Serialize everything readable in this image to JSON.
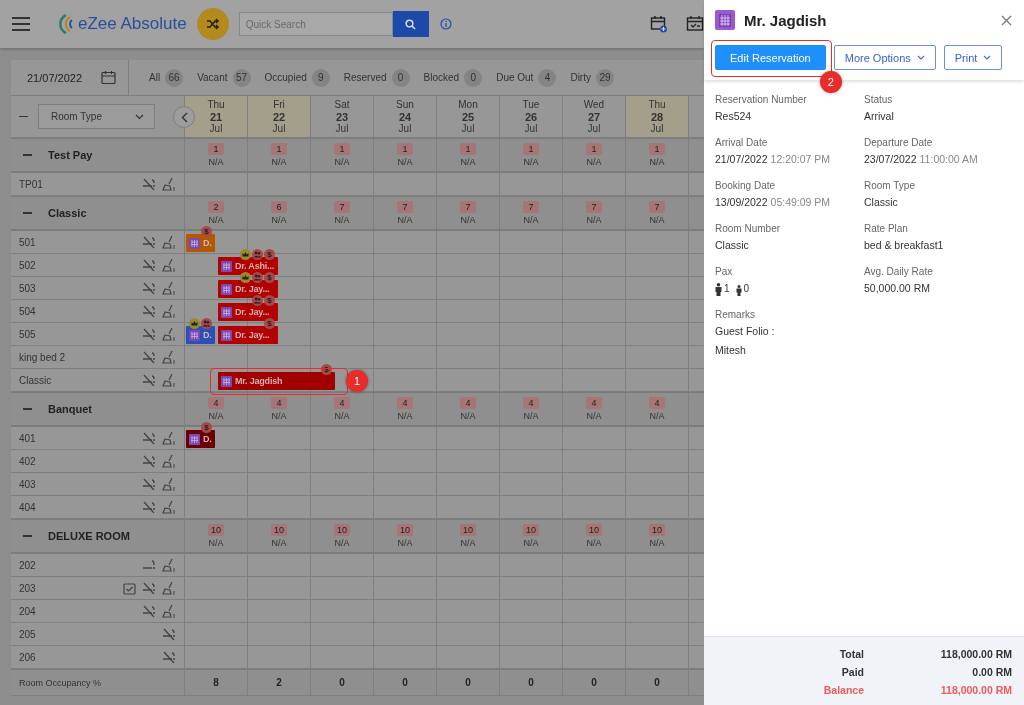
{
  "top_bar": {
    "app_name": "eZee Absolute",
    "search": {
      "placeholder": "Quick Search"
    }
  },
  "filters": {
    "date": "21/07/2022",
    "items": [
      {
        "label": "All",
        "count": "66"
      },
      {
        "label": "Vacant",
        "count": "57"
      },
      {
        "label": "Occupied",
        "count": "9"
      },
      {
        "label": "Reserved",
        "count": "0"
      },
      {
        "label": "Blocked",
        "count": "0"
      },
      {
        "label": "Due Out",
        "count": "4"
      },
      {
        "label": "Dirty",
        "count": "29"
      }
    ]
  },
  "grid": {
    "view_select": "Room Type",
    "days": [
      {
        "weekday": "Thu",
        "date": "21",
        "month": "Jul",
        "highlighted": true
      },
      {
        "weekday": "Fri",
        "date": "22",
        "month": "Jul",
        "highlighted": true
      },
      {
        "weekday": "Sat",
        "date": "23",
        "month": "Jul",
        "highlighted": false
      },
      {
        "weekday": "Sun",
        "date": "24",
        "month": "Jul",
        "highlighted": false
      },
      {
        "weekday": "Mon",
        "date": "25",
        "month": "Jul",
        "highlighted": false
      },
      {
        "weekday": "Tue",
        "date": "26",
        "month": "Jul",
        "highlighted": false
      },
      {
        "weekday": "Wed",
        "date": "27",
        "month": "Jul",
        "highlighted": false
      },
      {
        "weekday": "Thu",
        "date": "28",
        "month": "Jul",
        "highlighted": true
      }
    ],
    "groups": [
      {
        "name": "Test Pay",
        "availability": [
          "1",
          "1",
          "1",
          "1",
          "1",
          "1",
          "1",
          "1"
        ],
        "rates": [
          "N/A",
          "N/A",
          "N/A",
          "N/A",
          "N/A",
          "N/A",
          "N/A",
          "N/A"
        ],
        "rooms": [
          {
            "name": "TP01",
            "icons": [
              {
                "kind": "no_smoking"
              },
              {
                "kind": "dirty"
              }
            ]
          }
        ]
      },
      {
        "name": "Classic",
        "availability": [
          "2",
          "6",
          "7",
          "7",
          "7",
          "7",
          "7",
          "7"
        ],
        "rates": [
          "N/A",
          "N/A",
          "N/A",
          "N/A",
          "N/A",
          "N/A",
          "N/A",
          "N/A"
        ],
        "rooms": [
          {
            "name": "501",
            "icons": [
              {
                "kind": "no_smoking"
              },
              {
                "kind": "dirty"
              }
            ],
            "bookings": [
              {
                "guest": "D.",
                "kind": "departing",
                "color": "#b35a00",
                "badges": [
                  {
                    "kind": "payment",
                    "text": "$"
                  }
                ]
              }
            ]
          },
          {
            "name": "502",
            "icons": [
              {
                "kind": "no_smoking"
              },
              {
                "kind": "dirty"
              }
            ],
            "bookings": [
              {
                "guest": "Dr. Ashi...",
                "kind": "one_night",
                "color": "#b30000",
                "badges": [
                  {
                    "kind": "vip"
                  },
                  {
                    "kind": "group"
                  },
                  {
                    "kind": "payment",
                    "text": "$"
                  }
                ]
              }
            ]
          },
          {
            "name": "503",
            "icons": [
              {
                "kind": "no_smoking"
              },
              {
                "kind": "dirty"
              }
            ],
            "bookings": [
              {
                "guest": "Dr. Jay...",
                "kind": "one_night",
                "color": "#b30000",
                "badges": [
                  {
                    "kind": "vip"
                  },
                  {
                    "kind": "group"
                  },
                  {
                    "kind": "payment",
                    "text": "$"
                  }
                ]
              }
            ]
          },
          {
            "name": "504",
            "icons": [
              {
                "kind": "no_smoking"
              },
              {
                "kind": "dirty"
              }
            ],
            "bookings": [
              {
                "guest": "Dr. Jay...",
                "kind": "one_night",
                "color": "#b30000",
                "badges": [
                  {
                    "kind": "group"
                  },
                  {
                    "kind": "payment",
                    "text": "$"
                  }
                ]
              }
            ]
          },
          {
            "name": "505",
            "icons": [
              {
                "kind": "no_smoking"
              },
              {
                "kind": "dirty"
              }
            ],
            "bookings": [
              {
                "guest": "D.",
                "kind": "departing",
                "color": "#2a50b8",
                "badges": [
                  {
                    "kind": "vip"
                  },
                  {
                    "kind": "group"
                  }
                ]
              },
              {
                "guest": "Dr. Jay...",
                "kind": "one_night",
                "color": "#b30000",
                "badges": [
                  {
                    "kind": "payment",
                    "text": "$"
                  }
                ]
              }
            ]
          },
          {
            "name": "king bed 2",
            "icons": [
              {
                "kind": "no_smoking"
              },
              {
                "kind": "dirty"
              }
            ]
          },
          {
            "name": "Classic",
            "icons": [
              {
                "kind": "no_smoking"
              },
              {
                "kind": "dirty"
              }
            ],
            "bookings": [
              {
                "guest": "Mr. Jagdish",
                "kind": "two_nights",
                "color": "#a00000",
                "callout": "1",
                "badges": [
                  {
                    "kind": "payment",
                    "text": "$"
                  }
                ]
              }
            ]
          }
        ]
      },
      {
        "name": "Banquet",
        "availability": [
          "4",
          "4",
          "4",
          "4",
          "4",
          "4",
          "4",
          "4"
        ],
        "rates": [
          "N/A",
          "N/A",
          "N/A",
          "N/A",
          "N/A",
          "N/A",
          "N/A",
          "N/A"
        ],
        "rooms": [
          {
            "name": "401",
            "icons": [
              {
                "kind": "no_smoking"
              },
              {
                "kind": "dirty"
              }
            ],
            "bookings": [
              {
                "guest": "D.",
                "kind": "departing",
                "color": "#6a0000",
                "badges": [
                  {
                    "kind": "payment",
                    "text": "$"
                  }
                ]
              }
            ]
          },
          {
            "name": "402",
            "icons": [
              {
                "kind": "no_smoking"
              },
              {
                "kind": "dirty"
              }
            ]
          },
          {
            "name": "403",
            "icons": [
              {
                "kind": "no_smoking"
              },
              {
                "kind": "dirty"
              }
            ]
          },
          {
            "name": "404",
            "icons": [
              {
                "kind": "no_smoking"
              },
              {
                "kind": "dirty"
              }
            ]
          }
        ]
      },
      {
        "name": "DELUXE ROOM",
        "availability": [
          "10",
          "10",
          "10",
          "10",
          "10",
          "10",
          "10",
          "10"
        ],
        "rates": [
          "N/A",
          "N/A",
          "N/A",
          "N/A",
          "N/A",
          "N/A",
          "N/A",
          "N/A"
        ],
        "rooms": [
          {
            "name": "202",
            "icons": [
              {
                "kind": "smoking"
              },
              {
                "kind": "dirty"
              }
            ]
          },
          {
            "name": "203",
            "icons": [
              {
                "kind": "checklist"
              },
              {
                "kind": "no_smoking"
              },
              {
                "kind": "dirty"
              }
            ]
          },
          {
            "name": "204",
            "icons": [
              {
                "kind": "no_smoking"
              },
              {
                "kind": "dirty"
              }
            ]
          },
          {
            "name": "205",
            "icons": [
              {
                "kind": "no_smoking"
              }
            ]
          },
          {
            "name": "206",
            "icons": [
              {
                "kind": "no_smoking"
              }
            ]
          }
        ]
      }
    ],
    "occupancy": {
      "label": "Room Occupancy %",
      "values": [
        "8",
        "2",
        "0",
        "0",
        "0",
        "0",
        "0",
        "0"
      ]
    }
  },
  "panel": {
    "title": "Mr. Jagdish",
    "buttons": [
      {
        "label": "Edit Reservation",
        "kind": "primary",
        "dropdown": false,
        "callout": "2"
      },
      {
        "label": "More Options",
        "kind": "outline",
        "dropdown": true
      },
      {
        "label": "Print",
        "kind": "outline",
        "dropdown": true
      }
    ],
    "fields": [
      {
        "label": "Reservation Number",
        "kind": "text",
        "value": "Res524"
      },
      {
        "label": "Status",
        "kind": "text",
        "value": "Arrival"
      },
      {
        "label": "Arrival Date",
        "kind": "datetime",
        "value": "21/07/2022",
        "time": "12:20:07 PM"
      },
      {
        "label": "Departure Date",
        "kind": "datetime",
        "value": "23/07/2022",
        "time": "11:00:00 AM"
      },
      {
        "label": "Booking Date",
        "kind": "datetime",
        "value": "13/09/2022",
        "time": "05:49:09 PM"
      },
      {
        "label": "Room Type",
        "kind": "text",
        "value": "Classic"
      },
      {
        "label": "Room Number",
        "kind": "text",
        "value": "Classic"
      },
      {
        "label": "Rate Plan",
        "kind": "text",
        "value": "bed & breakfast1"
      },
      {
        "label": "Pax",
        "kind": "pax",
        "adults": "1",
        "children": "0"
      },
      {
        "label": "Avg. Daily Rate",
        "kind": "text",
        "value": "50,000.00 RM"
      },
      {
        "label": "Remarks",
        "kind": "lines",
        "lines": [
          "Guest Folio :",
          "Mitesh"
        ]
      }
    ],
    "totals": [
      {
        "label": "Total",
        "value": "118,000.00 RM",
        "due": false
      },
      {
        "label": "Paid",
        "value": "0.00 RM",
        "due": false
      },
      {
        "label": "Balance",
        "value": "118,000.00 RM",
        "due": true
      }
    ]
  }
}
